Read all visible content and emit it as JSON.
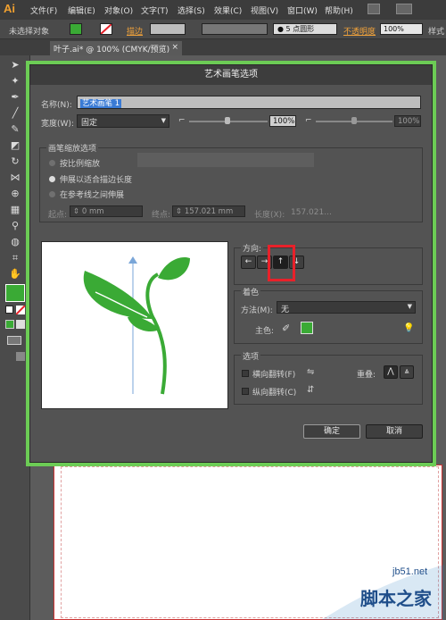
{
  "app": {
    "logo": "Ai"
  },
  "menu": [
    "文件(F)",
    "编辑(E)",
    "对象(O)",
    "文字(T)",
    "选择(S)",
    "效果(C)",
    "视图(V)",
    "窗口(W)",
    "帮助(H)"
  ],
  "options_bar": {
    "selection_label": "未选择对象",
    "stroke_label": "描边",
    "brush_value": "5 点圆形",
    "opacity_label": "不透明度",
    "opacity_value": "100%",
    "style_label": "样式"
  },
  "document_tab": {
    "title": "叶子.ai* @ 100% (CMYK/预览)",
    "close": "×"
  },
  "dialog": {
    "title": "艺术画笔选项",
    "name_label": "名称(N):",
    "name_value": "艺术画笔 1",
    "width_label": "宽度(W):",
    "width_value": "固定",
    "width_pct1": "100%",
    "width_pct2": "100%",
    "scale_group_title": "画笔缩放选项",
    "scale_options": [
      "按比例缩放",
      "伸展以适合描边长度",
      "在参考线之间伸展"
    ],
    "start_label": "起点:",
    "start_value": "0 mm",
    "end_label": "终点:",
    "end_value": "157.021 mm",
    "length_label": "长度(X):",
    "length_value": "157.021...",
    "direction_label": "方向:",
    "direction_arrows": [
      "←",
      "→",
      "↑",
      "↓"
    ],
    "colorize_title": "着色",
    "method_label": "方法(M):",
    "method_value": "无",
    "key_color_label": "主色:",
    "options_title": "选项",
    "flip_along": "横向翻转(F)",
    "flip_across": "纵向翻转(C)",
    "overlap_label": "重叠:",
    "ok_label": "确定",
    "cancel_label": "取消"
  },
  "watermark": {
    "site": "jb51.net",
    "text": "脚本之家"
  },
  "colors": {
    "accent_green": "#3aaa35",
    "highlight_red": "#e8212a",
    "dialog_frame": "#6ccc55"
  }
}
